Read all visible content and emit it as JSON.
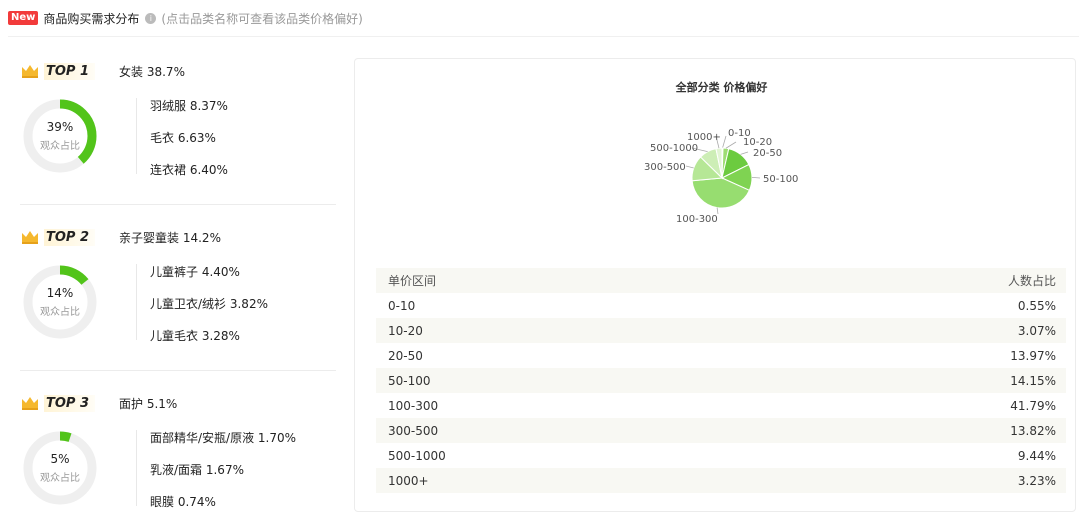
{
  "header": {
    "badge": "New",
    "title": "商品购买需求分布",
    "hint": "(点击品类名称可查看该品类价格偏好)"
  },
  "categories": [
    {
      "rank": "TOP 1",
      "name": "女装 38.7%",
      "percent_text": "39%",
      "percent": 0.387,
      "donut_label": "观众占比",
      "subs": [
        "羽绒服 8.37%",
        "毛衣 6.63%",
        "连衣裙 6.40%"
      ]
    },
    {
      "rank": "TOP 2",
      "name": "亲子婴童装 14.2%",
      "percent_text": "14%",
      "percent": 0.142,
      "donut_label": "观众占比",
      "subs": [
        "儿童裤子 4.40%",
        "儿童卫衣/绒衫 3.82%",
        "儿童毛衣 3.28%"
      ]
    },
    {
      "rank": "TOP 3",
      "name": "面护 5.1%",
      "percent_text": "5%",
      "percent": 0.051,
      "donut_label": "观众占比",
      "subs": [
        "面部精华/安瓶/原液 1.70%",
        "乳液/面霜 1.67%",
        "眼膜 0.74%"
      ]
    }
  ],
  "colors": {
    "accent": "#52c41a",
    "track": "#efefef",
    "pie": [
      "#6cd03e",
      "#85dc5a",
      "#9ce075",
      "#b8ea9c",
      "#cdf0b8",
      "#dff5d0",
      "#eaf8e0"
    ]
  },
  "chart_data": {
    "type": "pie",
    "title": "全部分类 价格偏好",
    "categories": [
      "0-10",
      "10-20",
      "20-50",
      "50-100",
      "100-300",
      "300-500",
      "500-1000",
      "1000+"
    ],
    "values": [
      0.55,
      3.07,
      13.97,
      14.15,
      41.79,
      13.82,
      9.44,
      3.23
    ]
  },
  "table": {
    "headers": [
      "单价区间",
      "人数占比"
    ],
    "rows": [
      [
        "0-10",
        "0.55%"
      ],
      [
        "10-20",
        "3.07%"
      ],
      [
        "20-50",
        "13.97%"
      ],
      [
        "50-100",
        "14.15%"
      ],
      [
        "100-300",
        "41.79%"
      ],
      [
        "300-500",
        "13.82%"
      ],
      [
        "500-1000",
        "9.44%"
      ],
      [
        "1000+",
        "3.23%"
      ]
    ]
  }
}
